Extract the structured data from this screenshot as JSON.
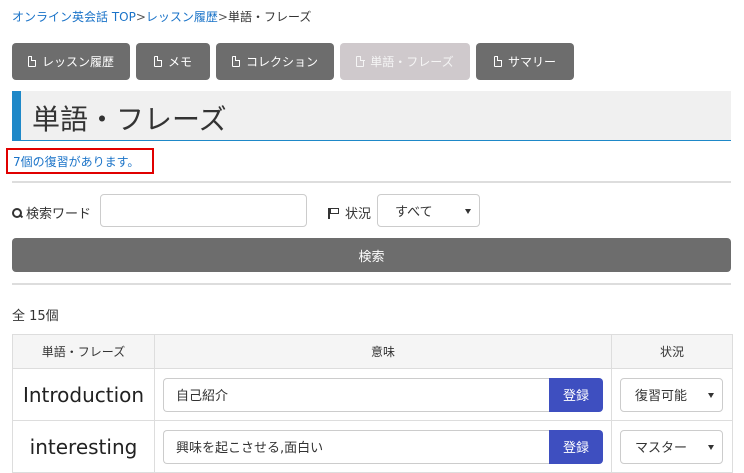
{
  "breadcrumb": {
    "items": [
      {
        "label": "オンライン英会話 TOP",
        "link": true
      },
      {
        "label": "レッスン履歴",
        "link": true
      },
      {
        "label": "単語・フレーズ",
        "link": false
      }
    ],
    "separator": ">"
  },
  "tabs": [
    {
      "label": "レッスン履歴",
      "icon": "document-icon",
      "active": false
    },
    {
      "label": "メモ",
      "icon": "document-icon",
      "active": false
    },
    {
      "label": "コレクション",
      "icon": "document-icon",
      "active": false
    },
    {
      "label": "単語・フレーズ",
      "icon": "document-icon",
      "active": true
    },
    {
      "label": "サマリー",
      "icon": "document-icon",
      "active": false
    }
  ],
  "page_title": "単語・フレーズ",
  "review_notice": "7個の復習があります。",
  "search": {
    "keyword_label": "検索ワード",
    "keyword_value": "",
    "status_label": "状況",
    "status_selected": "すべて",
    "button_label": "検索"
  },
  "total_count": "全 15個",
  "table": {
    "headers": [
      "単語・フレーズ",
      "意味",
      "状況"
    ],
    "register_label": "登録",
    "rows": [
      {
        "word": "Introduction",
        "meaning": "自己紹介",
        "status": "復習可能"
      },
      {
        "word": "interesting",
        "meaning": "興味を起こさせる,面白い",
        "status": "マスター"
      }
    ]
  },
  "colors": {
    "tab_bg": "#6d6d6d",
    "tab_active_bg": "#cfc9cc",
    "title_accent": "#1e88c8",
    "link": "#1a73c8",
    "highlight_border": "#e00000",
    "register_button": "#3e4fc0"
  }
}
